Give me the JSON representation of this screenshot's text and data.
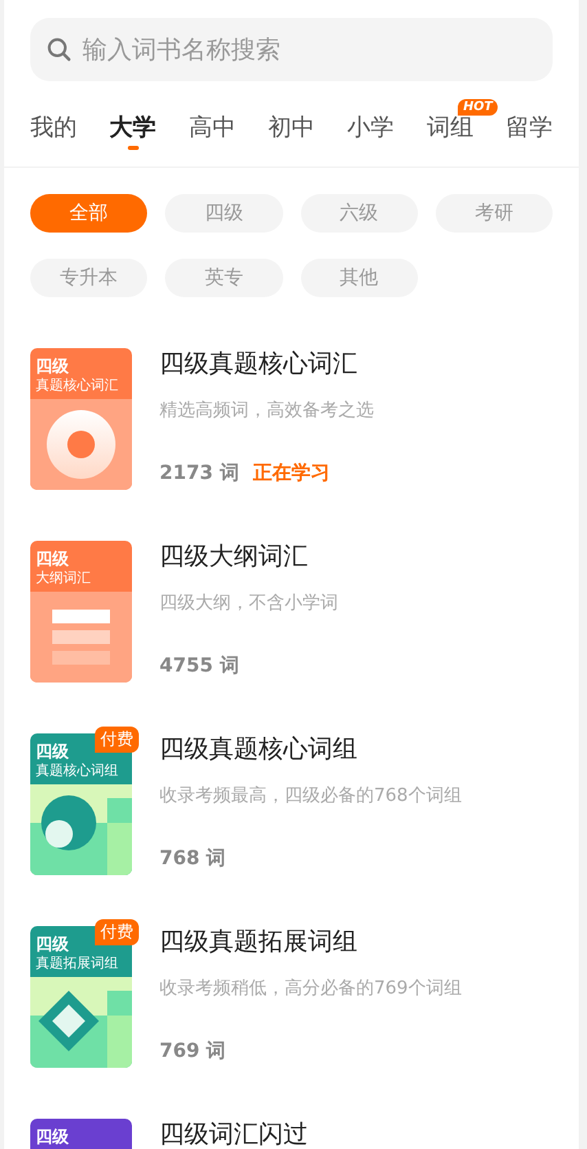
{
  "search": {
    "placeholder": "输入词书名称搜索"
  },
  "tabs": [
    {
      "label": "我的",
      "selected": false
    },
    {
      "label": "大学",
      "selected": true
    },
    {
      "label": "高中",
      "selected": false
    },
    {
      "label": "初中",
      "selected": false
    },
    {
      "label": "小学",
      "selected": false
    },
    {
      "label": "词组",
      "selected": false,
      "badge": "HOT"
    },
    {
      "label": "留学",
      "selected": false
    }
  ],
  "filters": [
    {
      "label": "全部",
      "selected": true
    },
    {
      "label": "四级",
      "selected": false
    },
    {
      "label": "六级",
      "selected": false
    },
    {
      "label": "考研",
      "selected": false
    },
    {
      "label": "专升本",
      "selected": false
    },
    {
      "label": "英专",
      "selected": false
    },
    {
      "label": "其他",
      "selected": false
    }
  ],
  "books": [
    {
      "cover": {
        "kind": "orange-circle",
        "level": "四级",
        "subtitle": "真题核心词汇"
      },
      "title": "四级真题核心词汇",
      "description": "精选高频词，高效备考之选",
      "count": "2173 词",
      "status": "正在学习"
    },
    {
      "cover": {
        "kind": "orange-bars",
        "level": "四级",
        "subtitle": "大纲词汇"
      },
      "title": "四级大纲词汇",
      "description": "四级大纲，不含小学词",
      "count": "4755 词"
    },
    {
      "cover": {
        "kind": "green-circle",
        "level": "四级",
        "subtitle": "真题核心词组"
      },
      "badge": "付费",
      "title": "四级真题核心词组",
      "description": "收录考频最高，四级必备的768个词组",
      "count": "768 词"
    },
    {
      "cover": {
        "kind": "green-diamond",
        "level": "四级",
        "subtitle": "真题拓展词组"
      },
      "badge": "付费",
      "title": "四级真题拓展词组",
      "description": "收录考频稍低，高分必备的769个词组",
      "count": "769 词"
    },
    {
      "cover": {
        "kind": "purple",
        "level": "四级"
      },
      "title": "四级词汇闪过"
    }
  ]
}
